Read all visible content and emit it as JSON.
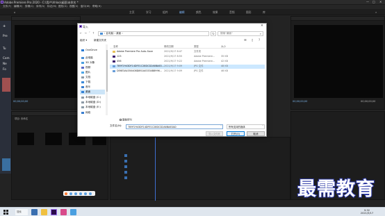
{
  "titlebar": {
    "title": "Adobe Premiere Pro 2020 - C:\\用户\\hhloo\\桌面\\未命名 *",
    "controls": [
      "—",
      "□",
      "✕"
    ]
  },
  "menubar": [
    "文件(F)",
    "编辑(E)",
    "剪辑(C)",
    "序列(S)",
    "标记(M)",
    "图形(G)",
    "视图(V)",
    "窗口(W)",
    "帮助(H)"
  ],
  "workspaces": [
    "主页",
    "学习",
    "组件",
    "编辑",
    "颜色",
    "效果",
    "音频",
    "图形",
    "库"
  ],
  "left_panel": {
    "timecode_left": "00;00;00;00",
    "timecode_right": "00;00;00;00",
    "project_label": "项目: 未命名",
    "tutorial_texts": [
      "Pre",
      "Tu",
      "Com",
      "Ne",
      "Fo"
    ]
  },
  "program_monitor": {
    "timecode_left": "00;00;00;00",
    "timecode_right": "00;00;00;00"
  },
  "dialog": {
    "title": "导入",
    "breadcrumb": "› 此电脑 › 桌面 ›",
    "search_placeholder": "搜索\"桌面\"",
    "toolbar": {
      "organize": "组织 ▾",
      "new_folder": "新建文件夹"
    },
    "nav_items": [
      {
        "label": "OneDrive",
        "icon": "onedrive-icon",
        "color": "#2b7cd3"
      },
      {
        "label": "此电脑",
        "icon": "computer-icon",
        "color": "#4a8fd6"
      },
      {
        "label": "3D 对象",
        "icon": "3d-objects-icon",
        "color": "#4a9fe0"
      },
      {
        "label": "视频",
        "icon": "video-icon",
        "color": "#5a6cc8"
      },
      {
        "label": "图片",
        "icon": "pictures-icon",
        "color": "#4ca6e8"
      },
      {
        "label": "文档",
        "icon": "documents-icon",
        "color": "#8c9aa6"
      },
      {
        "label": "下载",
        "icon": "downloads-icon",
        "color": "#3c8ad8"
      },
      {
        "label": "音乐",
        "icon": "music-icon",
        "color": "#3a7fd0"
      },
      {
        "label": "桌面",
        "icon": "desktop-icon",
        "color": "#2f80d6",
        "selected": true
      },
      {
        "label": "本地磁盘 (C:)",
        "icon": "drive-icon",
        "color": "#8c9aa6"
      },
      {
        "label": "本地磁盘 (D:)",
        "icon": "drive-icon",
        "color": "#8c9aa6"
      },
      {
        "label": "本地磁盘 (E:)",
        "icon": "drive-icon",
        "color": "#8c9aa6"
      },
      {
        "label": "网络",
        "icon": "network-icon",
        "color": "#3a7fd0"
      }
    ],
    "file_columns": [
      "名称",
      "修改日期",
      "类型",
      "大小"
    ],
    "files": [
      {
        "name": "Adobe Premiere Pro Auto-Save",
        "date": "2021/9/17 8:47",
        "type": "文件夹",
        "size": "",
        "icon": "folder-icon",
        "color": "#e8c25a"
      },
      {
        "name": "123",
        "date": "2021/9/17 8:55",
        "type": "Adobe Premiere...",
        "size": "35 KB",
        "icon": "premiere-file-icon",
        "color": "#3b1d6e"
      },
      {
        "name": "456",
        "date": "2021/9/17 9:22",
        "type": "Adobe Premiere...",
        "size": "42 KB",
        "icon": "premiere-file-icon",
        "color": "#3b1d6e"
      },
      {
        "name": "789F2943DF14DFE1C28DCD2A6BA63...",
        "date": "2021/9/17 9:09",
        "type": "JPG 文件",
        "size": "48 KB",
        "icon": "image-file-icon",
        "color": "#6a9ed8",
        "selected": true
      },
      {
        "name": "DE6E3A4350408D892A03334B8996...",
        "date": "2021/9/17 9:09",
        "type": "JPG 文件",
        "size": "46 KB",
        "icon": "image-file-icon",
        "color": "#6a9ed8"
      }
    ],
    "sequence_label": "图像序列",
    "filename_label": "文件名(N):",
    "filename_value": "789F2943DF14DFE1C28DCD2A6BA63AD",
    "filetype_value": "所有支持的媒体",
    "import_folder_label": "导入文件夹",
    "open_label": "打开(O)",
    "cancel_label": "取消"
  },
  "taskbar": {
    "search_text": "搜索",
    "time": "9:32",
    "date": "2021/9/17"
  },
  "watermark": "最需教育",
  "colors": {
    "accent_blue": "#2f80d6",
    "premiere_purple": "#9b6cf0",
    "watermark_stroke": "#2e3ba8"
  }
}
